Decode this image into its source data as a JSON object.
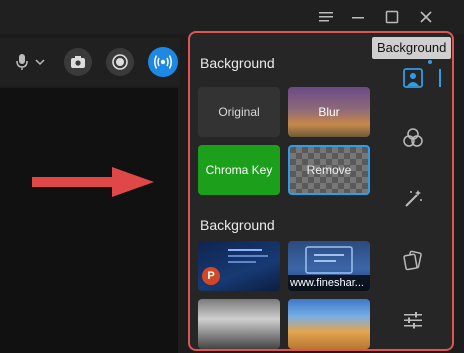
{
  "tooltip": "Background",
  "panel": {
    "section1_title": "Background",
    "section2_title": "Background",
    "tiles": [
      {
        "label": "Original"
      },
      {
        "label": "Blur"
      },
      {
        "label": "Chroma Key"
      },
      {
        "label": "Remove"
      }
    ],
    "images": [
      {
        "caption": ""
      },
      {
        "caption": "www.fineshar..."
      },
      {
        "caption": ""
      },
      {
        "caption": ""
      }
    ],
    "ppt_badge": "P"
  },
  "icons": {
    "titlebar": [
      "menu-icon",
      "minimize-icon",
      "maximize-icon",
      "close-icon"
    ],
    "toolbar": [
      "microphone-icon",
      "chevron-down-icon",
      "camera-icon",
      "record-icon",
      "live-broadcast-icon"
    ],
    "sidebar": [
      "person-background-icon",
      "filter-icon",
      "magic-wand-icon",
      "sticker-icon",
      "adjust-sliders-icon"
    ]
  },
  "colors": {
    "accent": "#2e9ee8",
    "highlight_border": "#e05454",
    "arrow": "#e04848",
    "chroma": "#1ca01c"
  }
}
